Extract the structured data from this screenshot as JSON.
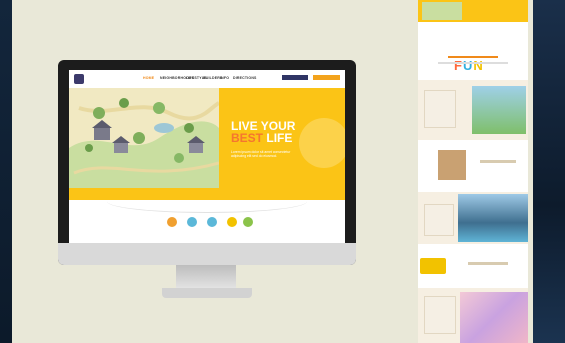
{
  "site": {
    "nav": [
      "HOME",
      "NEIGHBORHOODS",
      "LIFESTYLE",
      "BUILDERS",
      "INFO",
      "DIRECTIONS"
    ],
    "hero_line1": "LIVE YOUR",
    "hero_best": "BEST",
    "hero_life": "LIFE",
    "hero_sub": "Lorem ipsum dolor sit amet consectetur adipiscing elit sed do eiusmod."
  },
  "longpage": {
    "fun_letters": [
      "F",
      "U",
      "N"
    ],
    "fun_colors": [
      "#ff6a3d",
      "#33b0e0",
      "#f2c200"
    ],
    "colors": {
      "accent": "#fbc416",
      "orange": "#f3a31c",
      "navy": "#2f3565"
    }
  }
}
